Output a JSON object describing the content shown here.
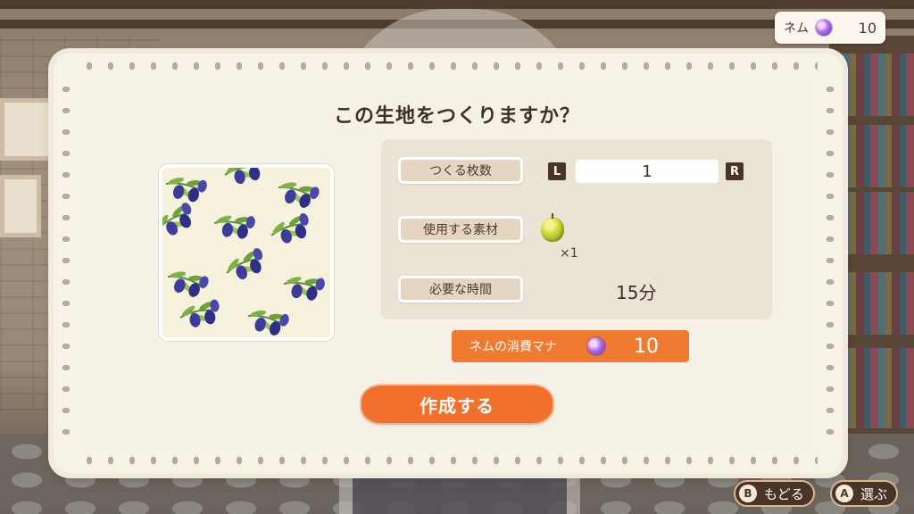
{
  "currency": {
    "label": "ネム",
    "value": "10",
    "icon": "mana-gem-icon"
  },
  "dialog": {
    "title": "この生地をつくりますか？",
    "rows": {
      "quantity_label": "つくる枚数",
      "quantity_value": "1",
      "prev_key": "L",
      "next_key": "R",
      "material_label": "使用する素材",
      "material_icon": "green-apple-icon",
      "material_count": "×1",
      "time_label": "必要な時間",
      "time_value": "15分"
    },
    "mana": {
      "label": "ネムの消費マナ",
      "icon": "mana-gem-icon",
      "value": "10"
    },
    "create_label": "作成する"
  },
  "hints": [
    {
      "key": "B",
      "label": "もどる"
    },
    {
      "key": "A",
      "label": "選ぶ"
    }
  ],
  "colors": {
    "accent": "#f0702c",
    "mana_bar": "#ef7a32",
    "panel": "#ebe3d6",
    "text": "#3c2f27"
  }
}
